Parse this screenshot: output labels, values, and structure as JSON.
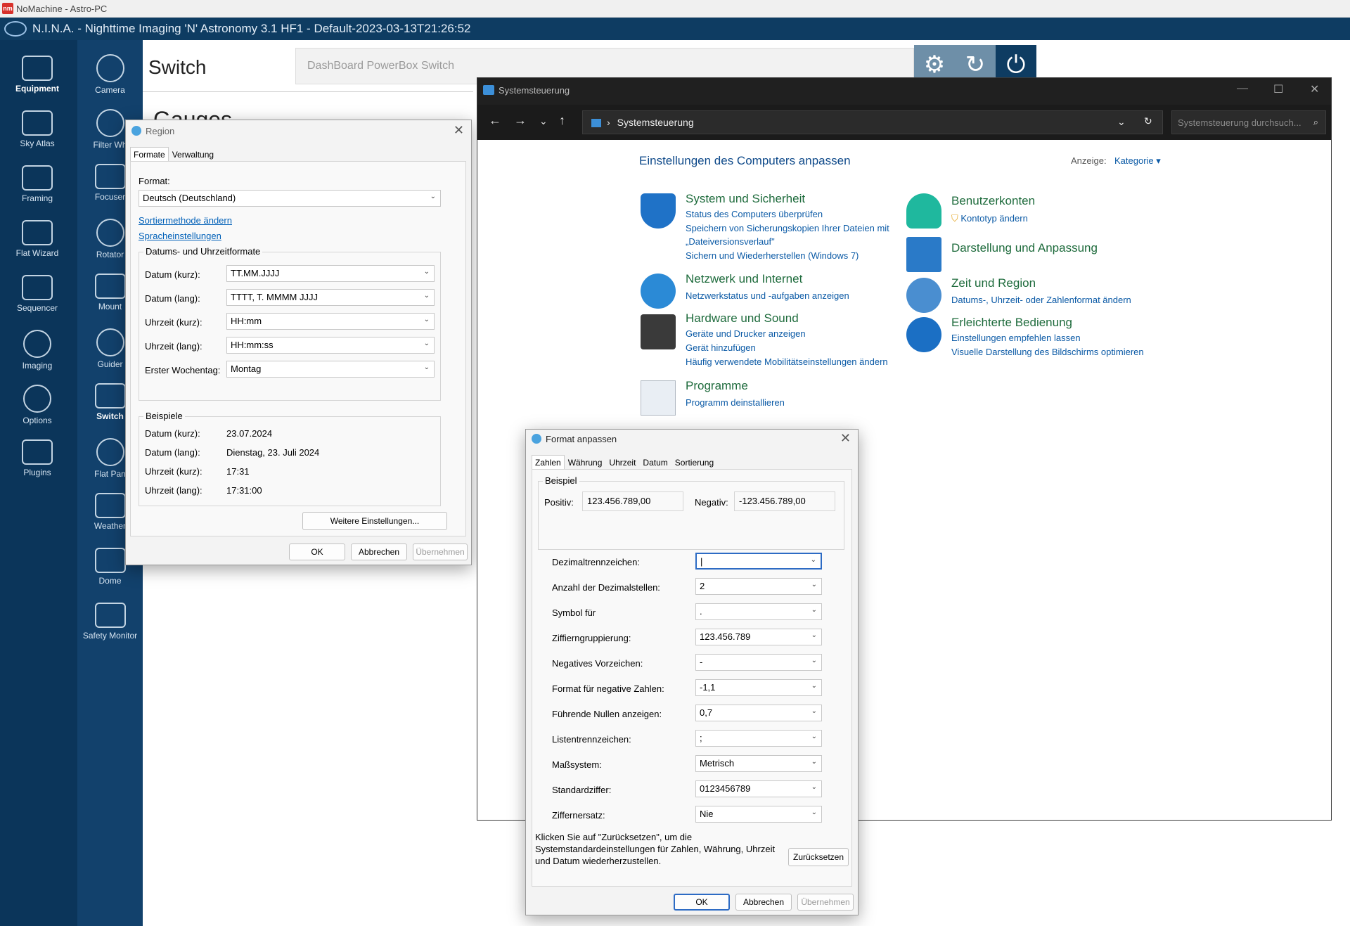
{
  "nomachine": {
    "title": "NoMachine - Astro-PC",
    "logo_text": "nm"
  },
  "nina": {
    "title": "N.I.N.A. - Nighttime Imaging 'N' Astronomy 3.1 HF1   -  Default-2023-03-13T21:26:52",
    "sidebar_main": [
      "Equipment",
      "Sky Atlas",
      "Framing",
      "Flat Wizard",
      "Sequencer",
      "Imaging",
      "Options",
      "Plugins"
    ],
    "sidebar_equipment": [
      "Camera",
      "Filter Wh",
      "Focuser",
      "Rotator",
      "Mount",
      "Guider",
      "Switch",
      "Flat Pan",
      "Weather",
      "Dome",
      "Safety Monitor"
    ],
    "page_title": "Switch",
    "gauges_title": "Gauges",
    "device_selector": "DashBoard PowerBox Switch"
  },
  "region": {
    "title": "Region",
    "tabs": [
      "Formate",
      "Verwaltung"
    ],
    "format_label": "Format:",
    "format_value": "Deutsch (Deutschland)",
    "link_sort": "Sortiermethode ändern",
    "link_language": "Spracheinstellungen",
    "group_formats": "Datums- und Uhrzeitformate",
    "rows": [
      {
        "label": "Datum (kurz):",
        "value": "TT.MM.JJJJ"
      },
      {
        "label": "Datum (lang):",
        "value": "TTTT, T. MMMM JJJJ"
      },
      {
        "label": "Uhrzeit (kurz):",
        "value": "HH:mm"
      },
      {
        "label": "Uhrzeit (lang):",
        "value": "HH:mm:ss"
      },
      {
        "label": "Erster Wochentag:",
        "value": "Montag"
      }
    ],
    "group_examples": "Beispiele",
    "examples": [
      {
        "label": "Datum (kurz):",
        "value": "23.07.2024"
      },
      {
        "label": "Datum (lang):",
        "value": "Dienstag, 23. Juli 2024"
      },
      {
        "label": "Uhrzeit (kurz):",
        "value": "17:31"
      },
      {
        "label": "Uhrzeit (lang):",
        "value": "17:31:00"
      }
    ],
    "more_settings": "Weitere Einstellungen...",
    "ok": "OK",
    "cancel": "Abbrechen",
    "apply": "Übernehmen"
  },
  "control_panel": {
    "title": "Systemsteuerung",
    "address": "Systemsteuerung",
    "search_placeholder": "Systemsteuerung durchsuch...",
    "heading": "Einstellungen des Computers anpassen",
    "view_label": "Anzeige:",
    "view_value": "Kategorie",
    "categories_left": [
      {
        "title": "System und Sicherheit",
        "links": [
          "Status des Computers überprüfen",
          "Speichern von Sicherungskopien Ihrer Dateien mit",
          "„Dateiversionsverlauf\"",
          "Sichern und Wiederherstellen (Windows 7)"
        ]
      },
      {
        "title": "Netzwerk und Internet",
        "links": [
          "Netzwerkstatus und -aufgaben anzeigen"
        ]
      },
      {
        "title": "Hardware und Sound",
        "links": [
          "Geräte und Drucker anzeigen",
          "Gerät hinzufügen",
          "Häufig verwendete Mobilitätseinstellungen ändern"
        ]
      },
      {
        "title": "Programme",
        "links": [
          "Programm deinstallieren"
        ]
      }
    ],
    "categories_right": [
      {
        "title": "Benutzerkonten",
        "links": [
          "Kontotyp ändern"
        ]
      },
      {
        "title": "Darstellung und Anpassung",
        "links": []
      },
      {
        "title": "Zeit und Region",
        "links": [
          "Datums-, Uhrzeit- oder Zahlenformat ändern"
        ]
      },
      {
        "title": "Erleichterte Bedienung",
        "links": [
          "Einstellungen empfehlen lassen",
          "Visuelle Darstellung des Bildschirms optimieren"
        ]
      }
    ]
  },
  "format": {
    "title": "Format anpassen",
    "tabs": [
      "Zahlen",
      "Währung",
      "Uhrzeit",
      "Datum",
      "Sortierung"
    ],
    "example_group": "Beispiel",
    "positive_label": "Positiv:",
    "positive_value": "123.456.789,00",
    "negative_label": "Negativ:",
    "negative_value": "-123.456.789,00",
    "rows": [
      {
        "label": "Dezimaltrennzeichen:",
        "value": "|"
      },
      {
        "label": "Anzahl der Dezimalstellen:",
        "value": "2"
      },
      {
        "label": "Symbol für",
        "value": "."
      },
      {
        "label": "Ziffierngruppierung:",
        "value": "123.456.789"
      },
      {
        "label": "Negatives Vorzeichen:",
        "value": "-"
      },
      {
        "label": "Format für negative Zahlen:",
        "value": "-1,1"
      },
      {
        "label": "Führende Nullen anzeigen:",
        "value": "0,7"
      },
      {
        "label": "Listentrennzeichen:",
        "value": ";"
      },
      {
        "label": "Maßsystem:",
        "value": "Metrisch"
      },
      {
        "label": "Standardziffer:",
        "value": "0123456789"
      },
      {
        "label": "Ziffernersatz:",
        "value": "Nie"
      }
    ],
    "reset_text": "Klicken Sie auf \"Zurücksetzen\", um die Systemstandardeinstellungen für Zahlen, Währung, Uhrzeit und Datum wiederherzustellen.",
    "reset": "Zurücksetzen",
    "ok": "OK",
    "cancel": "Abbrechen",
    "apply": "Übernehmen"
  },
  "colors": {
    "nina_dark": "#0b355a",
    "nina_mid": "#12416c",
    "cp_green": "#1e6b3c",
    "cp_link": "#0b5aa6",
    "accent": "#2d6bc4"
  }
}
